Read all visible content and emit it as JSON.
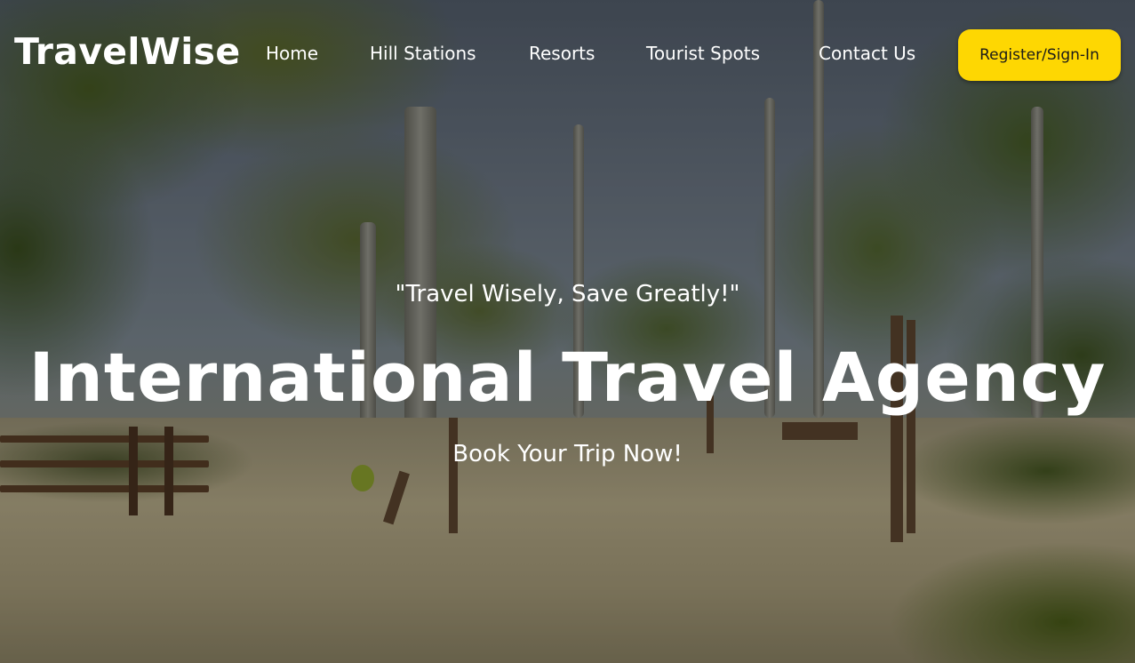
{
  "navbar": {
    "brand": "TravelWise",
    "links": [
      {
        "label": "Home"
      },
      {
        "label": "Hill Stations"
      },
      {
        "label": "Resorts"
      },
      {
        "label": "Tourist Spots"
      },
      {
        "label": "Contact Us"
      }
    ],
    "signin_label": "Register/Sign-In"
  },
  "hero": {
    "tagline": "\"Travel Wisely, Save Greatly!\"",
    "title": "International Travel Agency",
    "cta": "Book Your Trip Now!"
  },
  "colors": {
    "accent": "#fed702",
    "text": "#ffffff"
  }
}
